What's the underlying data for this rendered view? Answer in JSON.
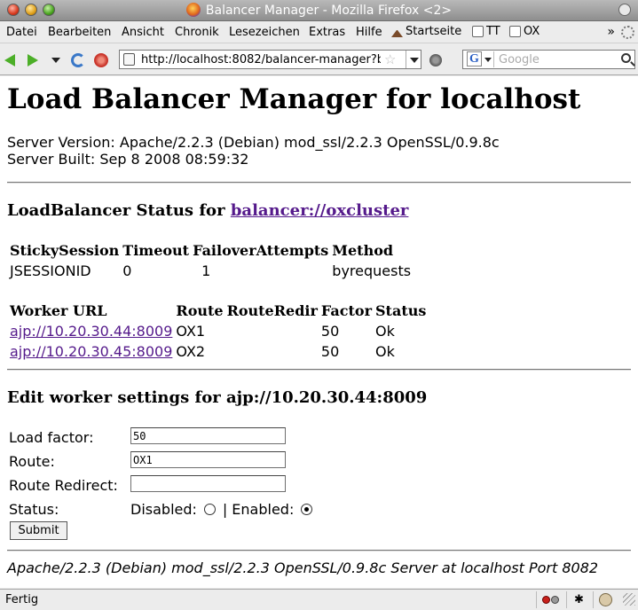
{
  "window": {
    "title": "Balancer Manager - Mozilla Firefox <2>"
  },
  "menu": {
    "items": [
      "Datei",
      "Bearbeiten",
      "Ansicht",
      "Chronik",
      "Lesezeichen",
      "Extras",
      "Hilfe"
    ],
    "bookmarks": [
      "Startseite",
      "TT",
      "OX"
    ],
    "overflow": "»"
  },
  "nav": {
    "url": "http://localhost:8082/balancer-manager?b",
    "search_engine": "G",
    "search_placeholder": "Google"
  },
  "page": {
    "title": "Load Balancer Manager for localhost",
    "server_version": "Server Version: Apache/2.2.3 (Debian) mod_ssl/2.2.3 OpenSSL/0.9.8c",
    "server_built": "Server Built: Sep 8 2008 08:59:32",
    "lb_status_prefix": "LoadBalancer Status for",
    "lb_link": "balancer://oxcluster",
    "lb_table": {
      "headers": [
        "StickySession",
        "Timeout",
        "FailoverAttempts",
        "Method"
      ],
      "row": [
        "JSESSIONID",
        "0",
        "1",
        "byrequests"
      ]
    },
    "workers_table": {
      "headers": [
        "Worker URL",
        "Route",
        "RouteRedir",
        "Factor",
        "Status"
      ],
      "rows": [
        [
          "ajp://10.20.30.44:8009",
          "OX1",
          "",
          "50",
          "Ok"
        ],
        [
          "ajp://10.20.30.45:8009",
          "OX2",
          "",
          "50",
          "Ok"
        ]
      ]
    },
    "edit_title": "Edit worker settings for ajp://10.20.30.44:8009",
    "form": {
      "load_factor_label": "Load factor:",
      "load_factor_value": "50",
      "route_label": "Route:",
      "route_value": "OX1",
      "route_redirect_label": "Route Redirect:",
      "route_redirect_value": "",
      "status_label": "Status:",
      "disabled_label": "Disabled:",
      "separator": "|",
      "enabled_label": "Enabled:",
      "submit_label": "Submit"
    },
    "footer": "Apache/2.2.3 (Debian) mod_ssl/2.2.3 OpenSSL/0.9.8c Server at localhost Port 8082"
  },
  "status_bar": {
    "text": "Fertig"
  }
}
